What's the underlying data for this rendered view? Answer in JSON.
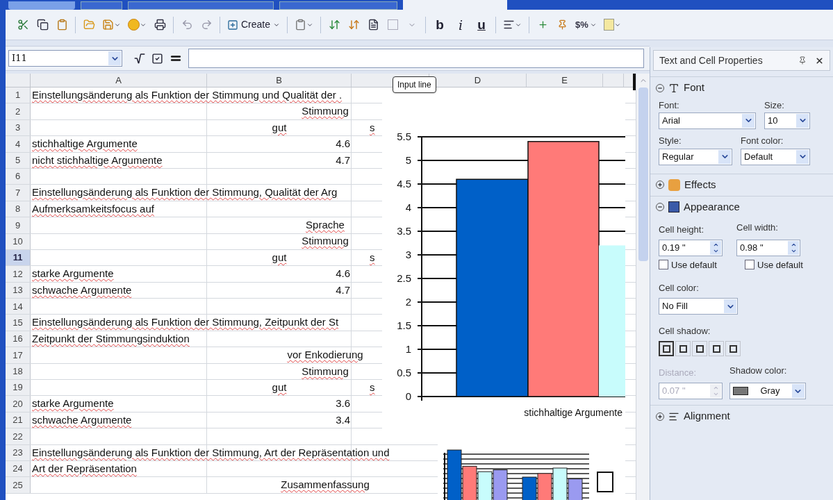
{
  "toolbar": {
    "create_label": "Create",
    "format_buttons": [
      "b",
      "i",
      "u"
    ],
    "currency_label": "$%"
  },
  "formula_bar": {
    "cell_reference": "I11"
  },
  "sheet": {
    "columns": [
      "A",
      "B",
      "D",
      "E"
    ],
    "rows": [
      {
        "number": "1",
        "selected": false,
        "cells": [
          {
            "kind": "label",
            "text": "Einstellungsänderung als Funktion der Stimmung und Qualität der ."
          }
        ]
      },
      {
        "number": "2",
        "selected": false,
        "cells": [
          {
            "kind": "heading",
            "text": "Stimmung"
          }
        ]
      },
      {
        "number": "3",
        "selected": false,
        "cells": [
          {
            "kind": "subheading",
            "text": "gut"
          },
          {
            "kind": "partial",
            "text": "s"
          }
        ]
      },
      {
        "number": "4",
        "selected": false,
        "cells": [
          {
            "kind": "label",
            "text": "stichhaltige Argumente"
          },
          {
            "kind": "value",
            "text": "4.6"
          }
        ]
      },
      {
        "number": "5",
        "selected": false,
        "cells": [
          {
            "kind": "label",
            "text": "nicht stichhaltige Argumente"
          },
          {
            "kind": "value",
            "text": "4.7"
          }
        ]
      },
      {
        "number": "6",
        "selected": false,
        "cells": []
      },
      {
        "number": "7",
        "selected": false,
        "cells": [
          {
            "kind": "label",
            "text": "Einstellungsänderung als Funktion der Stimmung, Qualität der Arg"
          }
        ]
      },
      {
        "number": "8",
        "selected": false,
        "cells": [
          {
            "kind": "label",
            "text": "Aufmerksamkeitsfocus auf"
          }
        ]
      },
      {
        "number": "9",
        "selected": false,
        "cells": [
          {
            "kind": "heading",
            "text": "Sprache"
          }
        ]
      },
      {
        "number": "10",
        "selected": false,
        "cells": [
          {
            "kind": "heading",
            "text": "Stimmung"
          }
        ]
      },
      {
        "number": "11",
        "selected": true,
        "cells": [
          {
            "kind": "subheading",
            "text": "gut"
          },
          {
            "kind": "partial",
            "text": "s"
          }
        ]
      },
      {
        "number": "12",
        "selected": false,
        "cells": [
          {
            "kind": "label",
            "text": "starke Argumente"
          },
          {
            "kind": "value",
            "text": "4.6"
          }
        ]
      },
      {
        "number": "13",
        "selected": false,
        "cells": [
          {
            "kind": "label",
            "text": "schwache Argumente"
          },
          {
            "kind": "value",
            "text": "4.7"
          }
        ]
      },
      {
        "number": "14",
        "selected": false,
        "cells": []
      },
      {
        "number": "15",
        "selected": false,
        "cells": [
          {
            "kind": "label",
            "text": "Einstellungsänderung als Funktion der Stimmung, Zeitpunkt der St"
          }
        ]
      },
      {
        "number": "16",
        "selected": false,
        "cells": [
          {
            "kind": "label",
            "text": "Zeitpunkt der Stimmungsinduktion"
          }
        ]
      },
      {
        "number": "17",
        "selected": false,
        "cells": [
          {
            "kind": "heading",
            "text": "vor Enkodierung"
          }
        ]
      },
      {
        "number": "18",
        "selected": false,
        "cells": [
          {
            "kind": "heading",
            "text": "Stimmung"
          }
        ]
      },
      {
        "number": "19",
        "selected": false,
        "cells": [
          {
            "kind": "subheading",
            "text": "gut"
          },
          {
            "kind": "partial",
            "text": "s"
          }
        ]
      },
      {
        "number": "20",
        "selected": false,
        "cells": [
          {
            "kind": "label",
            "text": "starke Argumente"
          },
          {
            "kind": "value",
            "text": "3.6"
          }
        ]
      },
      {
        "number": "21",
        "selected": false,
        "cells": [
          {
            "kind": "label",
            "text": "schwache Argumente"
          },
          {
            "kind": "value",
            "text": "3.4"
          }
        ]
      },
      {
        "number": "22",
        "selected": false,
        "cells": []
      },
      {
        "number": "23",
        "selected": false,
        "cells": [
          {
            "kind": "label",
            "text": "Einstellungsänderung als Funktion der Stimmung, Art der Repräsentation und"
          }
        ]
      },
      {
        "number": "24",
        "selected": false,
        "cells": [
          {
            "kind": "label",
            "text": "Art der Repräsentation"
          }
        ]
      },
      {
        "number": "25",
        "selected": false,
        "cells": [
          {
            "kind": "heading",
            "text": "Zusammenfassung"
          }
        ]
      }
    ],
    "tooltip": "Input line",
    "chart": {
      "chart_data": {
        "type": "bar",
        "categories": [
          "stichhaltige Argumente"
        ],
        "ylim": [
          0,
          5.5
        ],
        "yticks": [
          0,
          0.5,
          1,
          1.5,
          2,
          2.5,
          3,
          3.5,
          4,
          4.5,
          5,
          5.5
        ],
        "grid": true,
        "series": [
          {
            "color": "#0060c8",
            "values": [
              4.6
            ]
          },
          {
            "color": "#ff7a78",
            "values": [
              5.4
            ]
          },
          {
            "color": "#c8fcfc",
            "values": [
              3.2
            ]
          }
        ]
      }
    }
  },
  "panel": {
    "title": "Text and Cell Properties",
    "sections": [
      {
        "kind": "font",
        "title": "Font",
        "expanded": true,
        "font_label": "Font:",
        "font": "Arial",
        "size_label": "Size:",
        "size": "10",
        "style_label": "Style:",
        "style": "Regular",
        "color_label": "Font color:",
        "font_color": "Default"
      },
      {
        "kind": "effects",
        "title": "Effects",
        "expanded": false
      },
      {
        "kind": "appearance",
        "title": "Appearance",
        "expanded": true,
        "height_label": "Cell height:",
        "height": "0.19 \"",
        "width_label": "Cell width:",
        "width": "0.98 \"",
        "defaults": [
          {
            "label": "Use default",
            "checked": false
          },
          {
            "label": "Use default",
            "checked": false
          }
        ],
        "cell_color_label": "Cell color:",
        "cell_color": "No Fill",
        "shadow_label": "Cell shadow:",
        "shadows": [
          {
            "selected": true
          },
          {
            "selected": false
          },
          {
            "selected": false
          },
          {
            "selected": false
          },
          {
            "selected": false
          }
        ],
        "distance_label": "Distance:",
        "distance": "0.07 \"",
        "distance_disabled": true,
        "shadow_color_label": "Shadow color:",
        "shadow_color": "Gray"
      },
      {
        "kind": "alignment",
        "title": "Alignment",
        "expanded": false
      }
    ]
  }
}
